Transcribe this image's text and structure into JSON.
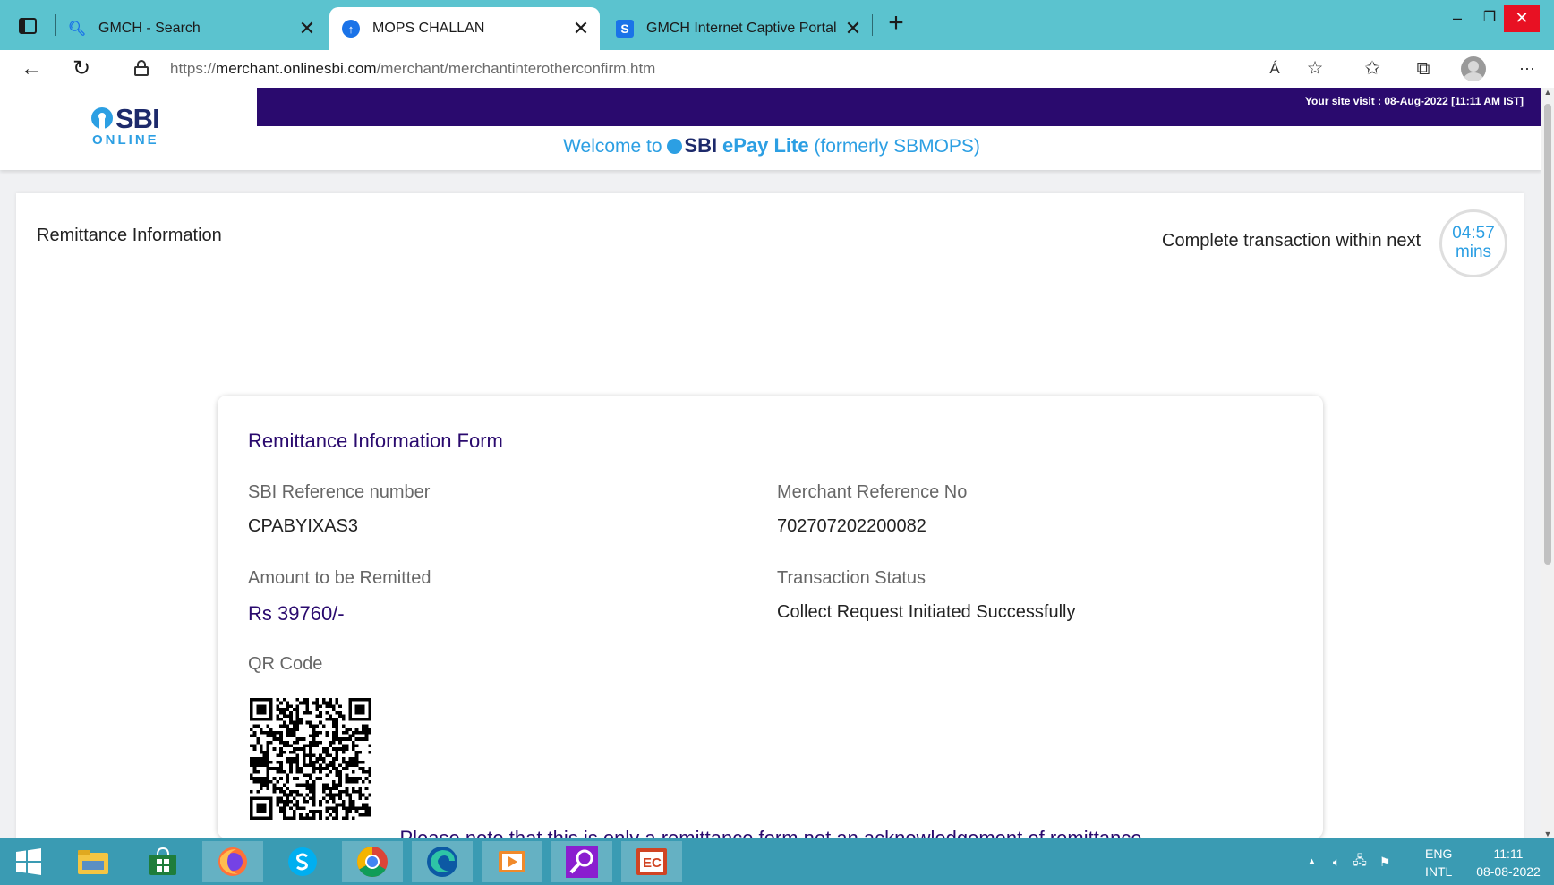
{
  "browser": {
    "tabs": [
      {
        "title": "GMCH - Search",
        "icon": "search-icon",
        "active": false
      },
      {
        "title": "MOPS CHALLAN",
        "icon": "sbi-favicon-icon",
        "active": true
      },
      {
        "title": "GMCH Internet Captive Portal",
        "icon": "s-favicon-icon",
        "active": false
      }
    ],
    "url_prefix": "https://",
    "url_host": "merchant.onlinesbi.com",
    "url_path": "/merchant/merchantinterotherconfirm.htm"
  },
  "header": {
    "logo_text": "SBI",
    "logo_subtext": "ONLINE",
    "site_visit": "Your site visit : 08-Aug-2022 [11:11 AM IST]",
    "welcome_prefix": "Welcome to",
    "welcome_brand": "SBI",
    "welcome_product": "ePay Lite",
    "welcome_suffix": "(formerly SBMOPS)"
  },
  "main": {
    "section_title": "Remittance Information",
    "timer_label": "Complete transaction within next",
    "timer_value": "04:57",
    "timer_unit": "mins"
  },
  "form": {
    "title": "Remittance Information Form",
    "sbi_ref_label": "SBI Reference number",
    "sbi_ref_value": "CPABYIXAS3",
    "merchant_ref_label": "Merchant Reference No",
    "merchant_ref_value": "702707202200082",
    "amount_label": "Amount to be Remitted",
    "amount_value": "Rs 39760/-",
    "status_label": "Transaction Status",
    "status_value": "Collect Request Initiated Successfully",
    "qr_label": "QR Code"
  },
  "note": "Please note that this is only a remittance form not an acknowledgement of remittance",
  "taskbar": {
    "apps": [
      "start-icon",
      "file-explorer-icon",
      "store-icon",
      "firefox-icon",
      "skype-icon",
      "chrome-icon",
      "edge-icon",
      "media-player-icon",
      "search-app-icon",
      "powerpoint-icon"
    ],
    "lang_top": "ENG",
    "lang_bottom": "INTL",
    "time": "11:11",
    "date": "08-08-2022"
  },
  "colors": {
    "tabstrip": "#5bc3cf",
    "header_bar": "#2a0a6e",
    "sbi_blue": "#2c9fe3",
    "taskbar": "#3a9bb3"
  }
}
